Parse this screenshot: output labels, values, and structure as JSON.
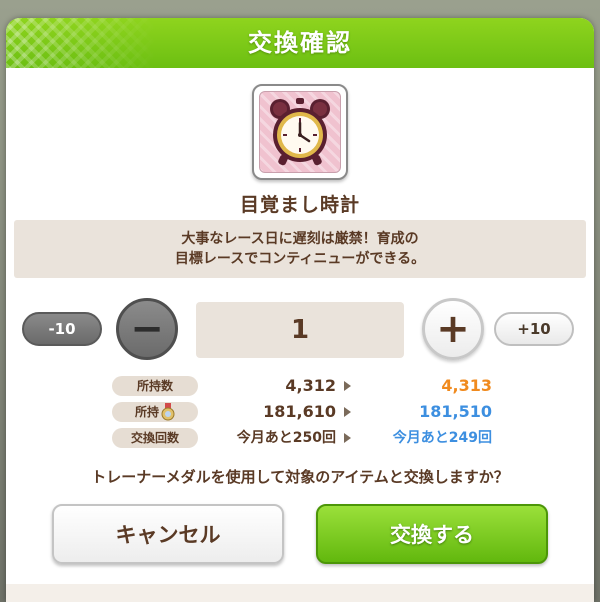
{
  "dialog": {
    "title": "交換確認",
    "item": {
      "icon": "alarm-clock-icon",
      "name": "目覚まし時計",
      "description_line1": "大事なレース日に遅刻は厳禁！育成の",
      "description_line2": "目標レースでコンティニューができる。"
    },
    "quantity": {
      "minus10_label": "-10",
      "minus_label": "−",
      "value": "1",
      "plus_label": "+",
      "plus10_label": "+10"
    },
    "stats": [
      {
        "label": "所持数",
        "current": "4,312",
        "after": "4,313"
      },
      {
        "label": "所持",
        "icon": "trainer-medal-icon",
        "current": "181,610",
        "after": "181,510"
      },
      {
        "label": "交換回数",
        "current": "今月あと250回",
        "after": "今月あと249回"
      }
    ],
    "question": "トレーナーメダルを使用して対象のアイテムと交換しますか？",
    "cancel_label": "キャンセル",
    "confirm_label": "交換する"
  },
  "colors": {
    "header_green": "#7cc81a",
    "after_orange": "#f08a1e",
    "after_blue": "#3d8fe0",
    "text_brown": "#5a3a25"
  }
}
